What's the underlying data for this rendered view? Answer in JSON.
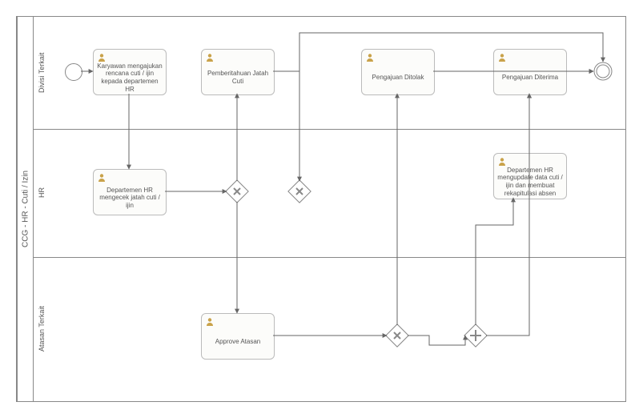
{
  "pool": {
    "title": "CCG - HR - Cuti / Izin"
  },
  "lanes": [
    {
      "id": "lane1",
      "title": "Divisi Terkait"
    },
    {
      "id": "lane2",
      "title": "HR"
    },
    {
      "id": "lane3",
      "title": "Atasan Terkait"
    }
  ],
  "tasks": {
    "t1": "Karyawan mengajukan rencana cuti / ijin kepada departemen HR",
    "t2": "Pemberitahuan Jatah Cuti",
    "t3": "Pengajuan Ditolak",
    "t4": "Pengajuan Diterima",
    "t5": "Departemen HR mengecek jatah cuti / ijin",
    "t6": "Departemen HR mengupdate data cuti / ijin dan membuat rekapitulasi absen",
    "t7": "Approve Atasan"
  },
  "chart_data": {
    "type": "bpmn-process",
    "pool": "CCG - HR - Cuti / Izin",
    "lanes": [
      "Divisi Terkait",
      "HR",
      "Atasan Terkait"
    ],
    "elements": [
      {
        "id": "start",
        "type": "startEvent",
        "lane": "Divisi Terkait"
      },
      {
        "id": "t1",
        "type": "userTask",
        "lane": "Divisi Terkait",
        "name": "Karyawan mengajukan rencana cuti / ijin kepada departemen HR"
      },
      {
        "id": "t2",
        "type": "userTask",
        "lane": "Divisi Terkait",
        "name": "Pemberitahuan Jatah Cuti"
      },
      {
        "id": "t3",
        "type": "userTask",
        "lane": "Divisi Terkait",
        "name": "Pengajuan Ditolak"
      },
      {
        "id": "t4",
        "type": "userTask",
        "lane": "Divisi Terkait",
        "name": "Pengajuan Diterima"
      },
      {
        "id": "t5",
        "type": "userTask",
        "lane": "HR",
        "name": "Departemen HR mengecek jatah cuti / ijin"
      },
      {
        "id": "t6",
        "type": "userTask",
        "lane": "HR",
        "name": "Departemen HR mengupdate data cuti / ijin dan membuat rekapitulasi absen"
      },
      {
        "id": "t7",
        "type": "userTask",
        "lane": "Atasan Terkait",
        "name": "Approve Atasan"
      },
      {
        "id": "g1",
        "type": "exclusiveGateway",
        "lane": "HR"
      },
      {
        "id": "g2",
        "type": "exclusiveGateway",
        "lane": "HR"
      },
      {
        "id": "g3",
        "type": "exclusiveGateway",
        "lane": "Atasan Terkait"
      },
      {
        "id": "g4",
        "type": "parallelGateway",
        "lane": "Atasan Terkait"
      },
      {
        "id": "end",
        "type": "endEvent-gateway",
        "lane": "Divisi Terkait"
      }
    ],
    "flows": [
      {
        "from": "start",
        "to": "t1"
      },
      {
        "from": "t1",
        "to": "t5"
      },
      {
        "from": "t5",
        "to": "g1"
      },
      {
        "from": "g1",
        "to": "t2"
      },
      {
        "from": "g1",
        "to": "t7"
      },
      {
        "from": "t2",
        "to": "g2"
      },
      {
        "from": "g2",
        "to": "end"
      },
      {
        "from": "t7",
        "to": "g3"
      },
      {
        "from": "g3",
        "to": "t3"
      },
      {
        "from": "g3",
        "to": "g4"
      },
      {
        "from": "g4",
        "to": "t6"
      },
      {
        "from": "g4",
        "to": "t4"
      },
      {
        "from": "t6",
        "to": "t4"
      },
      {
        "from": "t3",
        "to": "end"
      },
      {
        "from": "t4",
        "to": "end"
      }
    ]
  }
}
